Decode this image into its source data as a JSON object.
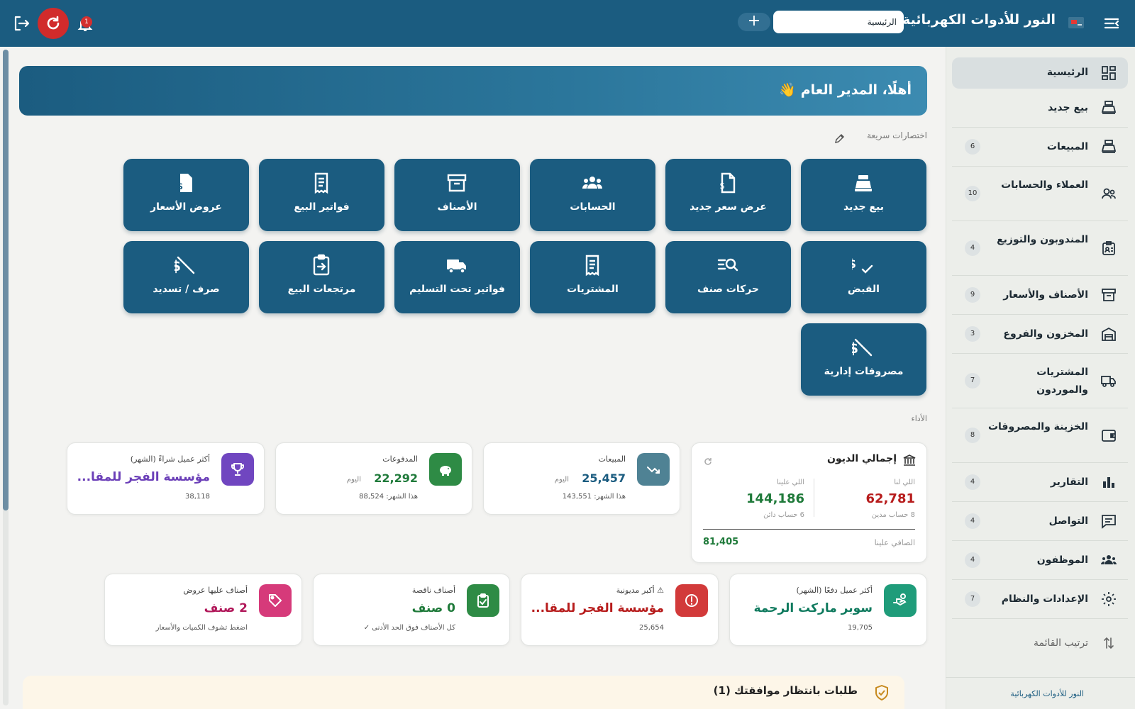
{
  "topbar": {
    "app_title": "النور للأدوات الكهربائية",
    "search_value": "الرئيسية",
    "add_label": "+",
    "notification_count": "1",
    "menu_icon": "menu-collapse-icon",
    "logout_icon": "logout-icon",
    "refresh_icon": "refresh-icon",
    "bell_icon": "bell-icon"
  },
  "welcome": {
    "text": "أهلًا، المدير العام 👋"
  },
  "shortcuts": {
    "heading": "اختصارات سريعة",
    "items": [
      {
        "label": "بيع جديد",
        "icon": "cash-register-icon"
      },
      {
        "label": "عرض سعر جديد",
        "icon": "quote-file-icon"
      },
      {
        "label": "الحسابات",
        "icon": "group-icon"
      },
      {
        "label": "الأصناف",
        "icon": "archive-box-icon"
      },
      {
        "label": "فواتير البيع",
        "icon": "receipt-icon"
      },
      {
        "label": "عروض الأسعار",
        "icon": "dollar-file-icon"
      },
      {
        "label": "القبض",
        "icon": "dollar-check-icon"
      },
      {
        "label": "حركات صنف",
        "icon": "search-list-icon"
      },
      {
        "label": "المشتريات",
        "icon": "purchase-receipt-icon"
      },
      {
        "label": "فواتير تحت التسليم",
        "icon": "truck-icon"
      },
      {
        "label": "مرتجعات البيع",
        "icon": "return-clipboard-icon"
      },
      {
        "label": "صرف / تسديد",
        "icon": "dollar-slash-icon"
      },
      {
        "label": "مصروفات إدارية",
        "icon": "dollar-slash-icon"
      }
    ]
  },
  "performance": {
    "heading": "الأداء",
    "debts": {
      "title": "إجمالي الديون",
      "owed_to_us_label": "اللي لنا",
      "owed_to_us_value": "62,781",
      "owed_to_us_sub": "8 حساب مدين",
      "owed_by_us_label": "اللي علينا",
      "owed_by_us_value": "144,186",
      "owed_by_us_sub": "6 حساب دائن",
      "net_label": "الصافي علينا",
      "net_value": "81,405"
    },
    "sales": {
      "label": "المبيعات",
      "value": "25,457",
      "unit": "اليوم",
      "month": "هذا الشهر: 143,551"
    },
    "payments": {
      "label": "المدفوعات",
      "value": "22,292",
      "unit": "اليوم",
      "month": "هذا الشهر: 88,524"
    },
    "top_buyer": {
      "label": "أكثر عميل شراءً (الشهر)",
      "name": "مؤسسة الفجر للمقا...",
      "value": "38,118"
    }
  },
  "stats": {
    "top_payer": {
      "label": "أكثر عميل دفعًا (الشهر)",
      "name": "سوبر ماركت الرحمة",
      "value": "19,705"
    },
    "top_debt": {
      "label": "⚠ أكبر مديونية",
      "name": "مؤسسة الفجر للمقا...",
      "value": "25,654"
    },
    "low_stock": {
      "label": "أصناف ناقصة",
      "name": "0 صنف",
      "note": "كل الأصناف فوق الحد الأدنى ✓"
    },
    "offers": {
      "label": "أصناف عليها عروض",
      "name": "2 صنف",
      "note": "اضغط تشوف الكميات والأسعار"
    }
  },
  "approvals": {
    "title": "طلبات بانتظار موافقتك (1)"
  },
  "sidebar": {
    "items": [
      {
        "label": "الرئيسية",
        "badge": "",
        "icon": "dashboard-grid-icon"
      },
      {
        "label": "بيع جديد",
        "badge": "",
        "icon": "cash-register-icon"
      },
      {
        "label": "المبيعات",
        "badge": "6",
        "icon": "cash-register-icon"
      },
      {
        "label": "العملاء والحسابات",
        "badge": "10",
        "icon": "users-icon"
      },
      {
        "label": "المندوبون والتوزيع",
        "badge": "4",
        "icon": "clipboard-users-icon"
      },
      {
        "label": "الأصناف والأسعار",
        "badge": "9",
        "icon": "archive-box-icon"
      },
      {
        "label": "المخزون والفروع",
        "badge": "3",
        "icon": "warehouse-icon"
      },
      {
        "label": "المشتريات والموردون",
        "badge": "7",
        "icon": "truck-icon"
      },
      {
        "label": "الخزينة والمصروفات",
        "badge": "8",
        "icon": "wallet-icon"
      },
      {
        "label": "التقارير",
        "badge": "4",
        "icon": "bar-chart-icon"
      },
      {
        "label": "التواصل",
        "badge": "4",
        "icon": "message-icon"
      },
      {
        "label": "الموظفون",
        "badge": "4",
        "icon": "team-icon"
      },
      {
        "label": "الإعدادات والنظام",
        "badge": "7",
        "icon": "gear-icon"
      }
    ],
    "sort_label": "ترتيب القائمة",
    "footer": "النور للأدوات الكهربائية"
  },
  "colors": {
    "primary": "#1b5c80",
    "danger": "#b71c1c",
    "success": "#1f7a3a",
    "purple": "#6b3fb8"
  }
}
